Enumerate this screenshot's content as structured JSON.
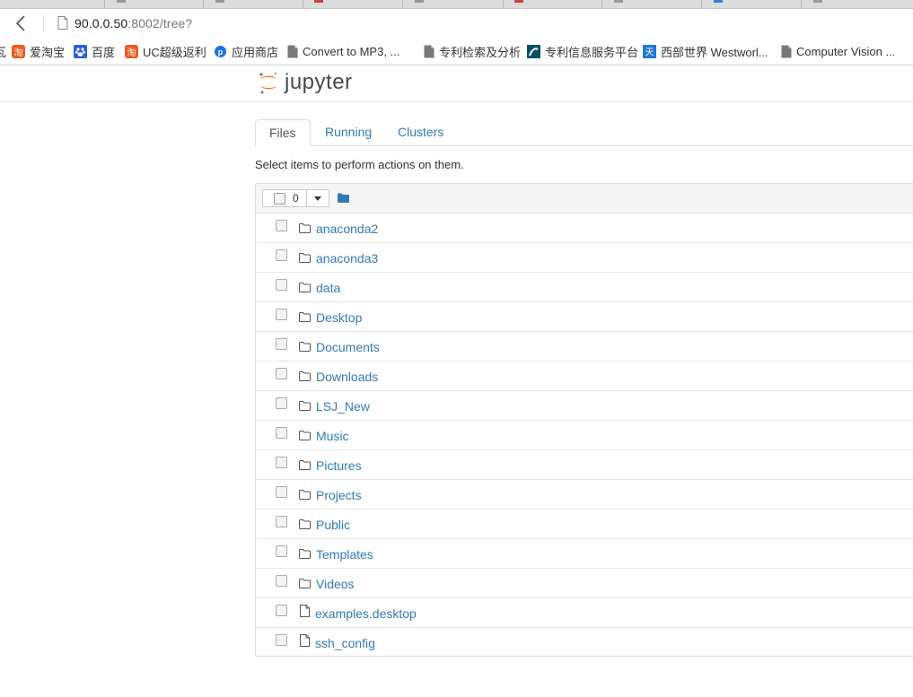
{
  "browser": {
    "url_host": "90.0.0.50",
    "url_rest": ":8002/tree?"
  },
  "bookmarks": [
    {
      "label": "爱淘宝",
      "icon": "taobao-icon"
    },
    {
      "label": "百度",
      "icon": "baidu-paw-icon"
    },
    {
      "label": "UC超级返利",
      "icon": "taobao-icon"
    },
    {
      "label": "应用商店",
      "icon": "app-store-icon"
    },
    {
      "label": "Convert to MP3, ...",
      "icon": "document-icon"
    },
    {
      "label": "专利检索及分析",
      "icon": "document-icon"
    },
    {
      "label": "专利信息服务平台",
      "icon": "patent-icon"
    },
    {
      "label": "西部世界 Westworl...",
      "icon": "westworld-icon"
    },
    {
      "label": "Computer Vision ...",
      "icon": "document-icon"
    }
  ],
  "header": {
    "logo_text": "jupyter"
  },
  "tabs": [
    {
      "label": "Files",
      "active": true
    },
    {
      "label": "Running",
      "active": false
    },
    {
      "label": "Clusters",
      "active": false
    }
  ],
  "hint": "Select items to perform actions on them.",
  "selection": {
    "count": "0"
  },
  "files": [
    {
      "name": "anaconda2",
      "type": "folder"
    },
    {
      "name": "anaconda3",
      "type": "folder"
    },
    {
      "name": "data",
      "type": "folder"
    },
    {
      "name": "Desktop",
      "type": "folder"
    },
    {
      "name": "Documents",
      "type": "folder"
    },
    {
      "name": "Downloads",
      "type": "folder"
    },
    {
      "name": "LSJ_New",
      "type": "folder"
    },
    {
      "name": "Music",
      "type": "folder"
    },
    {
      "name": "Pictures",
      "type": "folder"
    },
    {
      "name": "Projects",
      "type": "folder"
    },
    {
      "name": "Public",
      "type": "folder"
    },
    {
      "name": "Templates",
      "type": "folder"
    },
    {
      "name": "Videos",
      "type": "folder"
    },
    {
      "name": "examples.desktop",
      "type": "file"
    },
    {
      "name": "ssh_config",
      "type": "file"
    }
  ],
  "colors": {
    "link": "#337ab7",
    "jupyter_orange": "#f37726"
  }
}
